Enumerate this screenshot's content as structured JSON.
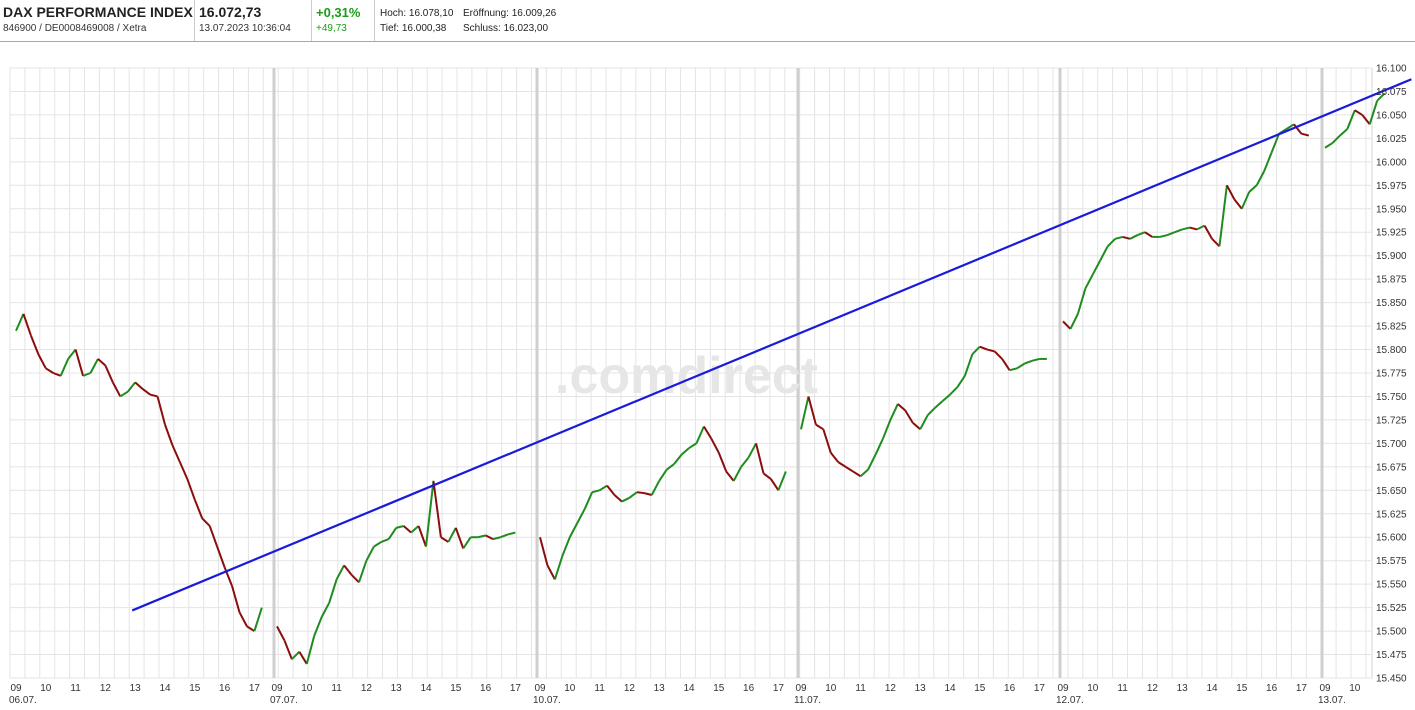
{
  "header": {
    "instrument_name": "DAX PERFORMANCE INDEX",
    "identifiers": "846900 / DE0008469008 / Xetra",
    "last_price": "16.072,73",
    "timestamp": "13.07.2023 10:36:04",
    "change_pct": "+0,31%",
    "change_abs": "+49,73",
    "high": "Hoch: 16.078,10",
    "open": "Eröffnung: 16.009,26",
    "low": "Tief: 16.000,38",
    "close": "Schluss: 16.023,00"
  },
  "watermark": ".comdirect",
  "colors": {
    "up_candle": "#1e8c1e",
    "down_candle": "#8b0d0d",
    "trendline": "#1a1adb",
    "grid": "#e4e4e4",
    "session_divider": "#cfcfcf",
    "change_positive": "#1a9c1a"
  },
  "chart_data": {
    "type": "line",
    "title": "",
    "xlabel": "",
    "ylabel": "",
    "ylim": [
      15450,
      16100
    ],
    "y_ticks": [
      "15.450",
      "15.475",
      "15.500",
      "15.525",
      "15.550",
      "15.575",
      "15.600",
      "15.625",
      "15.650",
      "15.675",
      "15.700",
      "15.725",
      "15.750",
      "15.775",
      "15.800",
      "15.825",
      "15.850",
      "15.875",
      "15.900",
      "15.925",
      "15.950",
      "15.975",
      "16.000",
      "16.025",
      "16.050",
      "16.075",
      "16.100"
    ],
    "y_tick_values": [
      15450,
      15475,
      15500,
      15525,
      15550,
      15575,
      15600,
      15625,
      15650,
      15675,
      15700,
      15725,
      15750,
      15775,
      15800,
      15825,
      15850,
      15875,
      15900,
      15925,
      15950,
      15975,
      16000,
      16025,
      16050,
      16075,
      16100
    ],
    "grid": true,
    "x_unit": "hours (trading time, 09 = session open)",
    "days": [
      {
        "date": "06.07.",
        "hour_labels": [
          "09",
          "10",
          "11",
          "12",
          "13",
          "14",
          "15",
          "16",
          "17"
        ]
      },
      {
        "date": "07.07.",
        "hour_labels": [
          "09",
          "10",
          "11",
          "12",
          "13",
          "14",
          "15",
          "16",
          "17"
        ]
      },
      {
        "date": "10.07.",
        "hour_labels": [
          "09",
          "10",
          "11",
          "12",
          "13",
          "14",
          "15",
          "16",
          "17"
        ]
      },
      {
        "date": "11.07.",
        "hour_labels": [
          "09",
          "10",
          "11",
          "12",
          "13",
          "14",
          "15",
          "16",
          "17"
        ]
      },
      {
        "date": "12.07.",
        "hour_labels": [
          "09",
          "10",
          "11",
          "12",
          "13",
          "14",
          "15",
          "16",
          "17"
        ]
      },
      {
        "date": "13.07.",
        "hour_labels": [
          "09",
          "10"
        ]
      }
    ],
    "series": [
      {
        "days": [
          {
            "date": "06.07.",
            "x": [
              9.0,
              9.25,
              9.5,
              9.75,
              10.0,
              10.25,
              10.5,
              10.75,
              11.0,
              11.25,
              11.5,
              11.75,
              12.0,
              12.25,
              12.5,
              12.75,
              13.0,
              13.25,
              13.5,
              13.75,
              14.0,
              14.25,
              14.5,
              14.75,
              15.0,
              15.25,
              15.5,
              15.75,
              16.0,
              16.25,
              16.5,
              16.75,
              17.0,
              17.25
            ],
            "y": [
              15820,
              15838,
              15815,
              15795,
              15780,
              15775,
              15772,
              15790,
              15800,
              15772,
              15775,
              15790,
              15783,
              15765,
              15750,
              15755,
              15765,
              15758,
              15752,
              15750,
              15720,
              15698,
              15680,
              15662,
              15640,
              15620,
              15612,
              15590,
              15568,
              15548,
              15520,
              15505,
              15500,
              15525
            ]
          },
          {
            "date": "07.07.",
            "x": [
              9.0,
              9.25,
              9.5,
              9.75,
              10.0,
              10.25,
              10.5,
              10.75,
              11.0,
              11.25,
              11.5,
              11.75,
              12.0,
              12.25,
              12.5,
              12.75,
              13.0,
              13.25,
              13.5,
              13.75,
              14.0,
              14.25,
              14.5,
              14.75,
              15.0,
              15.25,
              15.5,
              15.75,
              16.0,
              16.25,
              16.5,
              16.75,
              17.0
            ],
            "y": [
              15505,
              15490,
              15470,
              15478,
              15465,
              15495,
              15515,
              15530,
              15555,
              15570,
              15560,
              15552,
              15575,
              15590,
              15595,
              15598,
              15610,
              15612,
              15605,
              15612,
              15590,
              15660,
              15600,
              15595,
              15610,
              15588,
              15600,
              15600,
              15602,
              15598,
              15600,
              15603,
              15605
            ]
          },
          {
            "date": "10.07.",
            "x": [
              9.0,
              9.25,
              9.5,
              9.75,
              10.0,
              10.25,
              10.5,
              10.75,
              11.0,
              11.25,
              11.5,
              11.75,
              12.0,
              12.25,
              12.5,
              12.75,
              13.0,
              13.25,
              13.5,
              13.75,
              14.0,
              14.25,
              14.5,
              14.75,
              15.0,
              15.25,
              15.5,
              15.75,
              16.0,
              16.25,
              16.5,
              16.75,
              17.0,
              17.25
            ],
            "y": [
              15600,
              15570,
              15555,
              15580,
              15600,
              15615,
              15630,
              15648,
              15650,
              15655,
              15645,
              15638,
              15642,
              15648,
              15647,
              15645,
              15660,
              15672,
              15678,
              15688,
              15695,
              15700,
              15718,
              15705,
              15690,
              15670,
              15660,
              15675,
              15685,
              15700,
              15668,
              15662,
              15650,
              15670
            ]
          },
          {
            "date": "11.07.",
            "x": [
              9.0,
              9.25,
              9.5,
              9.75,
              10.0,
              10.25,
              10.5,
              10.75,
              11.0,
              11.25,
              11.5,
              11.75,
              12.0,
              12.25,
              12.5,
              12.75,
              13.0,
              13.25,
              13.5,
              13.75,
              14.0,
              14.25,
              14.5,
              14.75,
              15.0,
              15.25,
              15.5,
              15.75,
              16.0,
              16.25,
              16.5,
              16.75,
              17.0,
              17.25
            ],
            "y": [
              15715,
              15750,
              15720,
              15715,
              15690,
              15680,
              15675,
              15670,
              15665,
              15672,
              15688,
              15705,
              15725,
              15742,
              15735,
              15722,
              15715,
              15730,
              15738,
              15745,
              15752,
              15760,
              15772,
              15795,
              15803,
              15800,
              15798,
              15790,
              15778,
              15780,
              15785,
              15788,
              15790,
              15790
            ]
          },
          {
            "date": "12.07.",
            "x": [
              9.0,
              9.25,
              9.5,
              9.75,
              10.0,
              10.25,
              10.5,
              10.75,
              11.0,
              11.25,
              11.5,
              11.75,
              12.0,
              12.25,
              12.5,
              12.75,
              13.0,
              13.25,
              13.5,
              13.75,
              14.0,
              14.25,
              14.5,
              14.75,
              15.0,
              15.25,
              15.5,
              15.75,
              16.0,
              16.25,
              16.5,
              16.75,
              17.0,
              17.25
            ],
            "y": [
              15830,
              15822,
              15838,
              15865,
              15880,
              15895,
              15910,
              15918,
              15920,
              15918,
              15922,
              15925,
              15920,
              15920,
              15922,
              15925,
              15928,
              15930,
              15928,
              15932,
              15918,
              15910,
              15975,
              15960,
              15950,
              15968,
              15975,
              15990,
              16010,
              16030,
              16035,
              16040,
              16030,
              16028
            ]
          },
          {
            "date": "13.07.",
            "x": [
              9.0,
              9.25,
              9.5,
              9.75,
              10.0,
              10.25,
              10.5,
              10.75,
              11.0
            ],
            "y": [
              16015,
              16020,
              16028,
              16035,
              16055,
              16050,
              16040,
              16065,
              16073
            ]
          }
        ]
      }
    ],
    "trendline": {
      "from": {
        "date": "06.07.",
        "hour": 12.9,
        "y": 15522
      },
      "to": {
        "date": "13.07.",
        "hour": 11.9,
        "y": 16088
      }
    }
  }
}
